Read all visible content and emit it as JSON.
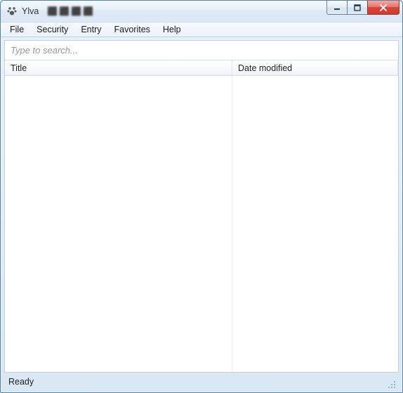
{
  "window": {
    "title": "Ylva"
  },
  "menu": {
    "items": [
      "File",
      "Security",
      "Entry",
      "Favorites",
      "Help"
    ]
  },
  "search": {
    "placeholder": "Type to search...",
    "value": ""
  },
  "list": {
    "columns": {
      "title": "Title",
      "date_modified": "Date modified"
    },
    "rows": []
  },
  "statusbar": {
    "text": "Ready"
  },
  "icons": {
    "app": "paw-icon",
    "minimize": "minimize-icon",
    "maximize": "maximize-icon",
    "close": "close-icon",
    "grip": "size-grip-icon"
  }
}
